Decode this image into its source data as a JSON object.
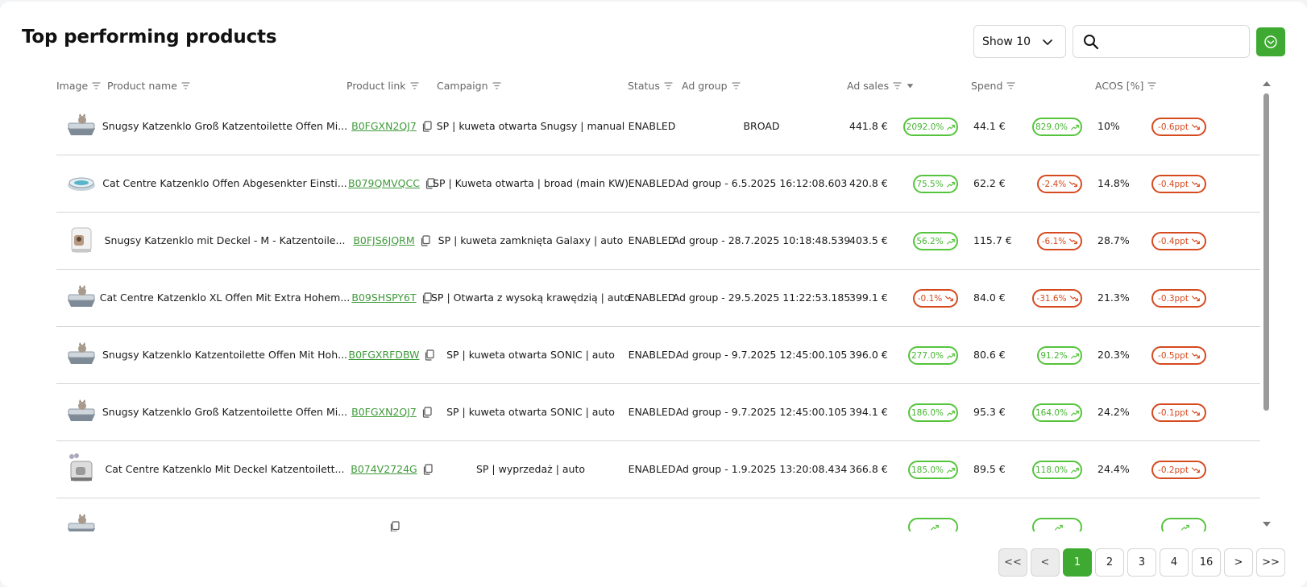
{
  "title": "Top performing products",
  "controls": {
    "show_select": "Show 10",
    "search_placeholder": ""
  },
  "columns": [
    "Image",
    "Product name",
    "Product link",
    "Campaign",
    "Status",
    "Ad group",
    "Ad sales",
    "Spend",
    "ACOS [%]"
  ],
  "colors": {
    "accent_green": "#3eaa31",
    "positive": "#55c43c",
    "negative": "#d64a1f",
    "link": "#3f9a3a"
  },
  "rows": [
    {
      "image": "cat-litter-box-grey-open-icon",
      "name": "Snugsy Katzenklo Groß Katzentoilette Offen Mi...",
      "link": "B0FGXN2QJ7",
      "campaign": "SP | kuweta otwarta Snugsy | manual",
      "status": "ENABLED",
      "ad_group": "BROAD",
      "ad_sales": "441.8 €",
      "ad_sales_change": "2092.0%",
      "ad_sales_dir": "up",
      "spend": "44.1 €",
      "spend_change": "829.0%",
      "spend_dir": "up",
      "acos": "10%",
      "acos_change": "-0.6ppt",
      "acos_dir": "down"
    },
    {
      "image": "cat-litter-tray-round-icon",
      "name": "Cat Centre Katzenklo Offen Abgesenkter Einsti...",
      "link": "B079QMVQCC",
      "campaign": "SP | Kuweta otwarta | broad (main KW)",
      "status": "ENABLED",
      "ad_group": "Ad group - 6.5.2025 16:12:08.603",
      "ad_sales": "420.8 €",
      "ad_sales_change": "75.5%",
      "ad_sales_dir": "up",
      "spend": "62.2 €",
      "spend_change": "-2.4%",
      "spend_dir": "down",
      "acos": "14.8%",
      "acos_change": "-0.4ppt",
      "acos_dir": "down"
    },
    {
      "image": "cat-litter-box-covered-white-icon",
      "name": "Snugsy Katzenklo mit Deckel - M - Katzentoile...",
      "link": "B0FJS6JQRM",
      "campaign": "SP | kuweta zamknięta Galaxy | auto",
      "status": "ENABLED",
      "ad_group": "Ad group - 28.7.2025 10:18:48.539",
      "ad_sales": "403.5 €",
      "ad_sales_change": "56.2%",
      "ad_sales_dir": "up",
      "spend": "115.7 €",
      "spend_change": "-6.1%",
      "spend_dir": "down",
      "acos": "28.7%",
      "acos_change": "-0.4ppt",
      "acos_dir": "down"
    },
    {
      "image": "cat-litter-box-grey-open-icon",
      "name": "Cat Centre Katzenklo XL Offen Mit Extra Hohem...",
      "link": "B09SHSPY6T",
      "campaign": "SP | Otwarta z wysoką krawędzią | auto",
      "status": "ENABLED",
      "ad_group": "Ad group - 29.5.2025 11:22:53.185",
      "ad_sales": "399.1 €",
      "ad_sales_change": "-0.1%",
      "ad_sales_dir": "down",
      "spend": "84.0 €",
      "spend_change": "-31.6%",
      "spend_dir": "down",
      "acos": "21.3%",
      "acos_change": "-0.3ppt",
      "acos_dir": "down"
    },
    {
      "image": "cat-litter-box-grey-open-icon",
      "name": "Snugsy Katzenklo Katzentoilette Offen Mit Hoh...",
      "link": "B0FGXRFDBW",
      "campaign": "SP | kuweta otwarta SONIC | auto",
      "status": "ENABLED",
      "ad_group": "Ad group - 9.7.2025 12:45:00.105",
      "ad_sales": "396.0 €",
      "ad_sales_change": "277.0%",
      "ad_sales_dir": "up",
      "spend": "80.6 €",
      "spend_change": "91.2%",
      "spend_dir": "up",
      "acos": "20.3%",
      "acos_change": "-0.5ppt",
      "acos_dir": "down"
    },
    {
      "image": "cat-litter-box-grey-open-icon",
      "name": "Snugsy Katzenklo Groß Katzentoilette Offen Mi...",
      "link": "B0FGXN2QJ7",
      "campaign": "SP | kuweta otwarta SONIC | auto",
      "status": "ENABLED",
      "ad_group": "Ad group - 9.7.2025 12:45:00.105",
      "ad_sales": "394.1 €",
      "ad_sales_change": "186.0%",
      "ad_sales_dir": "up",
      "spend": "95.3 €",
      "spend_change": "164.0%",
      "spend_dir": "up",
      "acos": "24.2%",
      "acos_change": "-0.1ppt",
      "acos_dir": "down"
    },
    {
      "image": "cat-litter-box-covered-grey-icon",
      "name": "Cat Centre Katzenklo Mit Deckel Katzentoilett...",
      "link": "B074V2724G",
      "campaign": "SP | wyprzedaż | auto",
      "status": "ENABLED",
      "ad_group": "Ad group - 1.9.2025 13:20:08.434",
      "ad_sales": "366.8 €",
      "ad_sales_change": "185.0%",
      "ad_sales_dir": "up",
      "spend": "89.5 €",
      "spend_change": "118.0%",
      "spend_dir": "up",
      "acos": "24.4%",
      "acos_change": "-0.2ppt",
      "acos_dir": "down"
    },
    {
      "image": "cat-litter-box-grey-open-icon",
      "name": "",
      "link": "",
      "campaign": "",
      "status": "",
      "ad_group": "",
      "ad_sales": "",
      "ad_sales_change": "",
      "ad_sales_dir": "up",
      "spend": "",
      "spend_change": "",
      "spend_dir": "up",
      "acos": "",
      "acos_change": "",
      "acos_dir": "up"
    }
  ],
  "pagination": {
    "first": "<<",
    "prev": "<",
    "pages": [
      "1",
      "2",
      "3",
      "4",
      "16"
    ],
    "next": ">",
    "last": ">>",
    "current": "1"
  }
}
